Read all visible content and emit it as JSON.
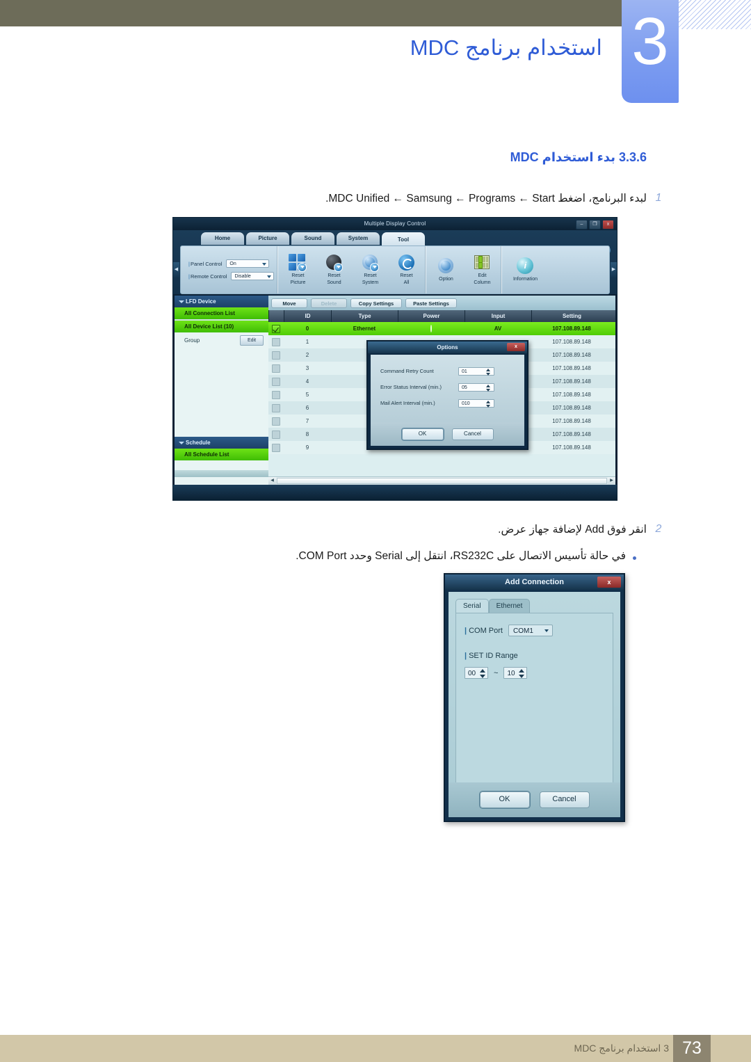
{
  "page": {
    "chapter_number": "3",
    "chapter_title": "استخدام برنامج MDC",
    "section_heading": "3.3.6 بدء استخدام MDC",
    "footer_text": "3 استخدام برنامج MDC",
    "footer_page": "73"
  },
  "steps": [
    {
      "num": "1",
      "text": "لبدء البرنامج، اضغط MDC Unified ← Samsung ← Programs ← Start."
    },
    {
      "num": "2",
      "text": "انقر فوق Add لإضافة جهاز عرض."
    }
  ],
  "bullets": [
    {
      "text": "في حالة تأسيس الاتصال على RS232C، انتقل إلى Serial وحدد COM Port."
    }
  ],
  "mdc_window": {
    "title": "Multiple Display Control",
    "window_buttons": {
      "minimize": "–",
      "maximize": "❐",
      "close": "x"
    },
    "help_label": "?",
    "tabs": [
      {
        "label": "Home",
        "active": false
      },
      {
        "label": "Picture",
        "active": false
      },
      {
        "label": "Sound",
        "active": false
      },
      {
        "label": "System",
        "active": false
      },
      {
        "label": "Tool",
        "active": true
      }
    ],
    "ribbon_controls": [
      {
        "label": "Panel Control",
        "value": "On"
      },
      {
        "label": "Remote Control",
        "value": "Disable"
      }
    ],
    "ribbon_buttons": [
      {
        "label_line1": "Reset",
        "label_line2": "Picture",
        "icon": "reset-picture-icon"
      },
      {
        "label_line1": "Reset",
        "label_line2": "Sound",
        "icon": "reset-sound-icon"
      },
      {
        "label_line1": "Reset",
        "label_line2": "System",
        "icon": "reset-system-icon"
      },
      {
        "label_line1": "Reset",
        "label_line2": "All",
        "icon": "reset-all-icon"
      },
      {
        "label_line1": "Option",
        "label_line2": "",
        "icon": "option-icon"
      },
      {
        "label_line1": "Edit",
        "label_line2": "Column",
        "icon": "edit-column-icon"
      },
      {
        "label_line1": "Information",
        "label_line2": "",
        "icon": "information-icon"
      }
    ],
    "ribbon_arrow_left": "◀",
    "ribbon_arrow_right": "▶",
    "sidebar": {
      "lfd_header": "LFD Device",
      "all_connection_list": "All Connection List",
      "all_device_list": "All Device List (10)",
      "group_label": "Group",
      "group_edit_button": "Edit",
      "schedule_header": "Schedule",
      "all_schedule_list": "All Schedule List"
    },
    "toolbar_buttons": [
      {
        "label": "Move",
        "disabled": false
      },
      {
        "label": "Delete",
        "disabled": true
      },
      {
        "label": "Copy Settings",
        "disabled": false
      },
      {
        "label": "Paste Settings",
        "disabled": false
      }
    ],
    "table": {
      "columns": [
        "ID",
        "Type",
        "Power",
        "Input",
        "Setting"
      ],
      "rows": [
        {
          "checked": true,
          "id": "0",
          "type": "Ethernet",
          "power": "on",
          "input": "AV",
          "setting": "107.108.89.148"
        },
        {
          "checked": false,
          "id": "1",
          "type": "",
          "power": "",
          "input": "",
          "setting": "107.108.89.148"
        },
        {
          "checked": false,
          "id": "2",
          "type": "",
          "power": "",
          "input": "",
          "setting": "107.108.89.148"
        },
        {
          "checked": false,
          "id": "3",
          "type": "",
          "power": "",
          "input": "",
          "setting": "107.108.89.148"
        },
        {
          "checked": false,
          "id": "4",
          "type": "",
          "power": "",
          "input": "",
          "setting": "107.108.89.148"
        },
        {
          "checked": false,
          "id": "5",
          "type": "",
          "power": "",
          "input": "",
          "setting": "107.108.89.148"
        },
        {
          "checked": false,
          "id": "6",
          "type": "",
          "power": "",
          "input": "",
          "setting": "107.108.89.148"
        },
        {
          "checked": false,
          "id": "7",
          "type": "",
          "power": "",
          "input": "",
          "setting": "107.108.89.148"
        },
        {
          "checked": false,
          "id": "8",
          "type": "",
          "power": "",
          "input": "",
          "setting": "107.108.89.148"
        },
        {
          "checked": false,
          "id": "9",
          "type": "",
          "power": "",
          "input": "",
          "setting": "107.108.89.148"
        }
      ],
      "scroll_left_arrow": "◀",
      "scroll_right_arrow": "▶"
    },
    "options_dialog": {
      "title": "Options",
      "close_label": "x",
      "fields": [
        {
          "label": "Command Retry Count",
          "value": "01"
        },
        {
          "label": "Error Status Interval (min.)",
          "value": "05"
        },
        {
          "label": "Mail Alert Interval (min.)",
          "value": "010"
        }
      ],
      "ok_button": "OK",
      "cancel_button": "Cancel"
    }
  },
  "add_connection_dialog": {
    "title": "Add Connection",
    "close_label": "x",
    "tabs": [
      {
        "label": "Serial",
        "active": true
      },
      {
        "label": "Ethernet",
        "active": false
      }
    ],
    "com_port_label": "COM Port",
    "com_port_value": "COM1",
    "set_id_range_label": "SET ID Range",
    "set_id_from": "00",
    "set_id_separator": "~",
    "set_id_to": "10",
    "ok_button": "OK",
    "cancel_button": "Cancel"
  },
  "colors": {
    "olive": "#6d6c59",
    "accent_blue": "#2f5cd6",
    "footer_tan": "#d2c7a8",
    "footer_box": "#8d8570",
    "green_row": "#5ad70a"
  }
}
